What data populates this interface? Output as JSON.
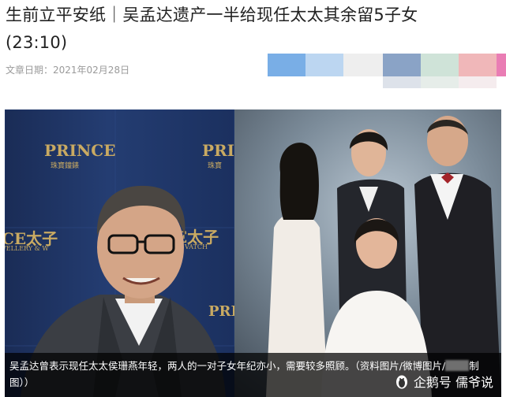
{
  "article": {
    "title_line1": "生前立平安纸｜吴孟达遗产一半给现任太太其余留5子女",
    "title_line2": "(23:10)",
    "date": "文章日期：2021年02月28日"
  },
  "swatches": [
    {
      "color": "#79aee6"
    },
    {
      "color": "#bcd6f1"
    },
    {
      "color": "#eeeeee"
    },
    {
      "color": "#8aa3c6"
    },
    {
      "color": "#cfe3d8"
    },
    {
      "color": "#f0b7b9"
    },
    {
      "color": "#f3dde0"
    }
  ],
  "photo": {
    "brand_left": "PRINCE",
    "brand_left_sub": "珠寶鐘錶",
    "brand_mid": "PRIN",
    "brand_mid_sub": "珠寶",
    "brand_bottom": "CE太子",
    "brand_bottom_sub": "VELLERY & W",
    "brand_bottom2": "CE太子",
    "brand_bottom2_sub": "VATCH",
    "brand_corner": "PRIN"
  },
  "caption": {
    "text_part1": "吴孟达曾表示现任太太侯珊燕年轻，两人的一对子女年纪亦小，需要较多照顾。（资料图片/微博图片/",
    "text_part2": "制图））"
  },
  "watermark": {
    "label": "企鹅号 儒爷说",
    "icon": "penguin-icon"
  }
}
